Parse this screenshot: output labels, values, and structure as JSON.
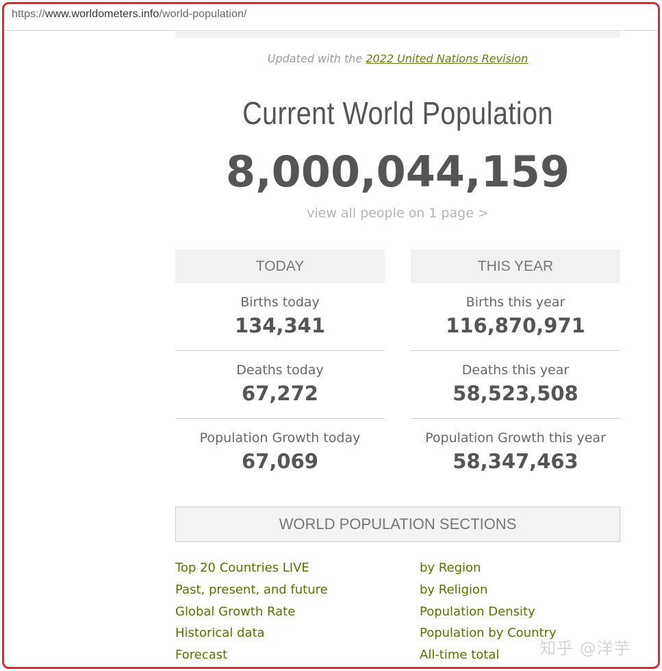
{
  "browser": {
    "url_prefix": "https://",
    "url_host": "www.worldometers.info",
    "url_path": "/world-population/"
  },
  "header": {
    "updated_prefix": "Updated with the ",
    "updated_link": "2022 United Nations Revision",
    "title": "Current World Population",
    "population": "8,000,044,159",
    "view_all": "view all people on 1 page >"
  },
  "today": {
    "heading": "TODAY",
    "items": [
      {
        "label": "Births today",
        "value": "134,341"
      },
      {
        "label": "Deaths today",
        "value": "67,272"
      },
      {
        "label": "Population Growth today",
        "value": "67,069"
      }
    ]
  },
  "this_year": {
    "heading": "THIS YEAR",
    "items": [
      {
        "label": "Births this year",
        "value": "116,870,971"
      },
      {
        "label": "Deaths this year",
        "value": "58,523,508"
      },
      {
        "label": "Population Growth this year",
        "value": "58,347,463"
      }
    ]
  },
  "sections": {
    "heading": "WORLD POPULATION SECTIONS",
    "left_links": [
      "Top 20 Countries LIVE",
      "Past, present, and future",
      "Global Growth Rate",
      "Historical data",
      "Forecast"
    ],
    "right_links": [
      "by Region",
      "by Religion",
      "Population Density",
      "Population by Country",
      "All-time total"
    ]
  },
  "watermark": "知乎 @洋芋",
  "colors": {
    "frame_border": "#e0262e",
    "link_green": "#5a6f00",
    "text_gray": "#555555"
  }
}
